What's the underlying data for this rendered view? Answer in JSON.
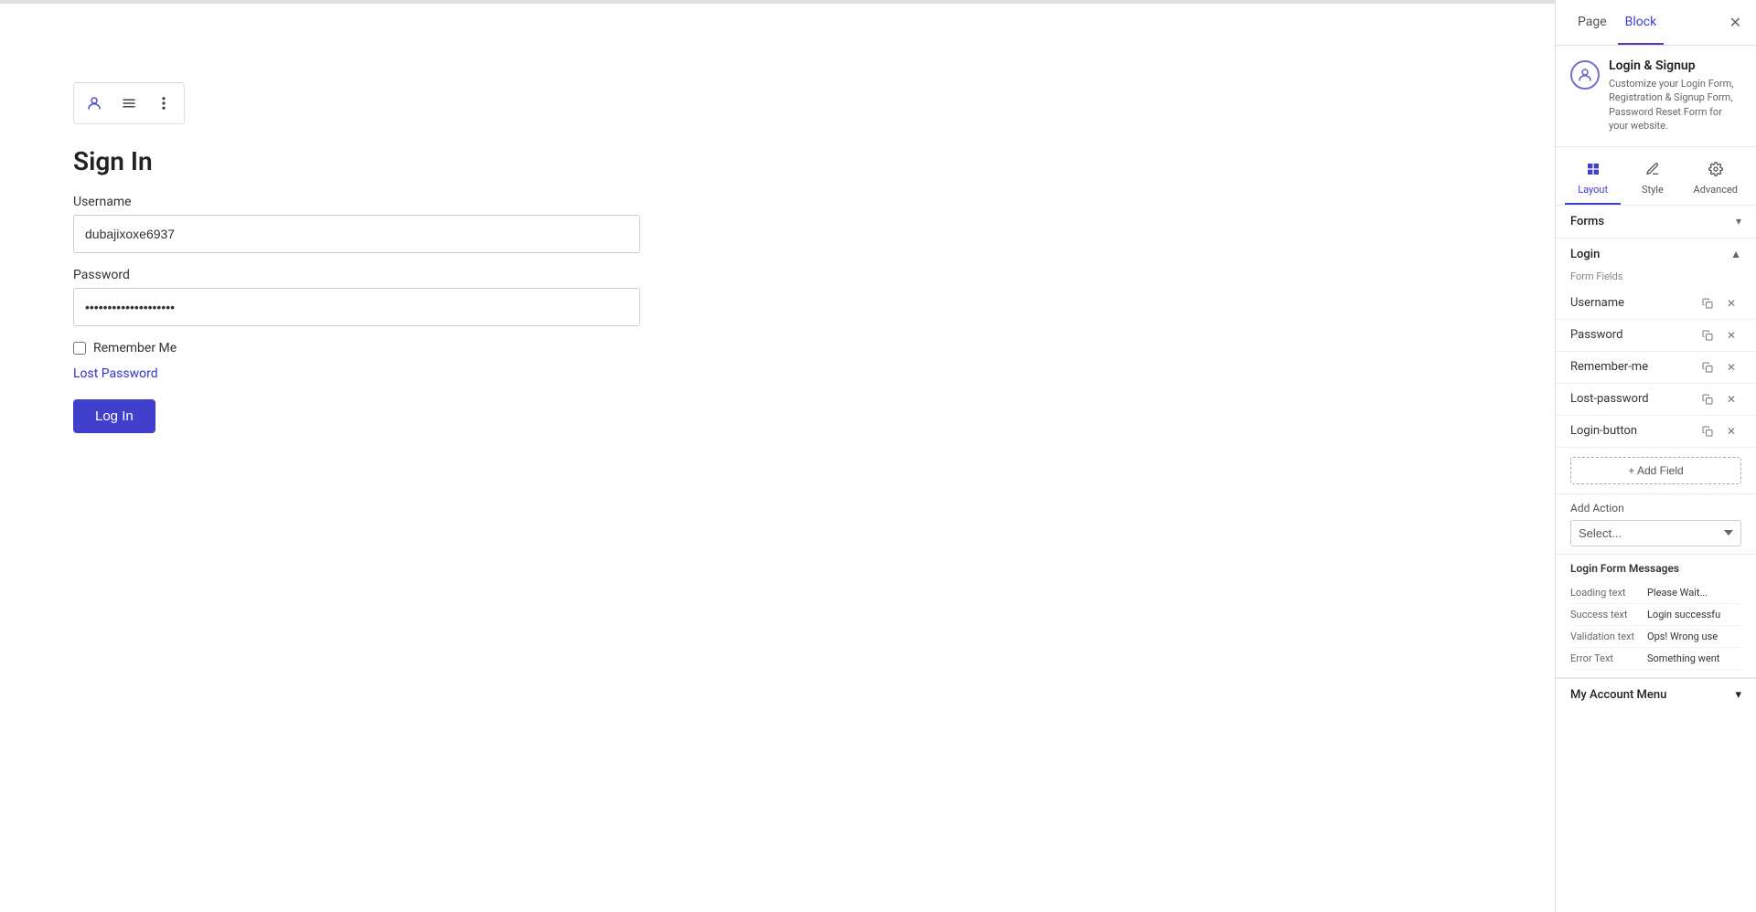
{
  "tabs": {
    "page": "Page",
    "block": "Block"
  },
  "block_info": {
    "title": "Login & Signup",
    "description": "Customize your Login Form, Registration & Signup Form, Password Reset Form for your website.",
    "icon": "👤"
  },
  "view_tabs": [
    {
      "id": "layout",
      "label": "Layout",
      "icon": "⊞",
      "active": true
    },
    {
      "id": "style",
      "label": "Style",
      "icon": "✏️",
      "active": false
    },
    {
      "id": "advanced",
      "label": "Advanced",
      "icon": "⚙️",
      "active": false
    }
  ],
  "forms_section": {
    "label": "Forms",
    "chevron": "▾"
  },
  "login_section": {
    "label": "Login",
    "chevron": "▲"
  },
  "form_fields_label": "Form Fields",
  "form_fields": [
    {
      "id": "username",
      "name": "Username"
    },
    {
      "id": "password",
      "name": "Password"
    },
    {
      "id": "remember-me",
      "name": "Remember-me"
    },
    {
      "id": "lost-password",
      "name": "Lost-password"
    },
    {
      "id": "login-button",
      "name": "Login-button"
    }
  ],
  "add_field_label": "+ Add Field",
  "add_action": {
    "label": "Add Action",
    "placeholder": "Select..."
  },
  "login_form_messages": {
    "title": "Login Form Messages",
    "fields": [
      {
        "id": "loading",
        "label": "Loading text",
        "value": "Please Wait..."
      },
      {
        "id": "success",
        "label": "Success text",
        "value": "Login successfu"
      },
      {
        "id": "validation",
        "label": "Validation text",
        "value": "Ops! Wrong use"
      },
      {
        "id": "error",
        "label": "Error Text",
        "value": "Something went"
      }
    ]
  },
  "my_account_menu": {
    "label": "My Account Menu",
    "chevron": "▾"
  },
  "main_form": {
    "title": "Sign In",
    "username_label": "Username",
    "username_value": "dubajixoxe6937",
    "password_label": "Password",
    "password_value": "••••••••••••••••••••",
    "remember_me_label": "Remember Me",
    "lost_password_label": "Lost Password",
    "login_button_label": "Log In"
  }
}
